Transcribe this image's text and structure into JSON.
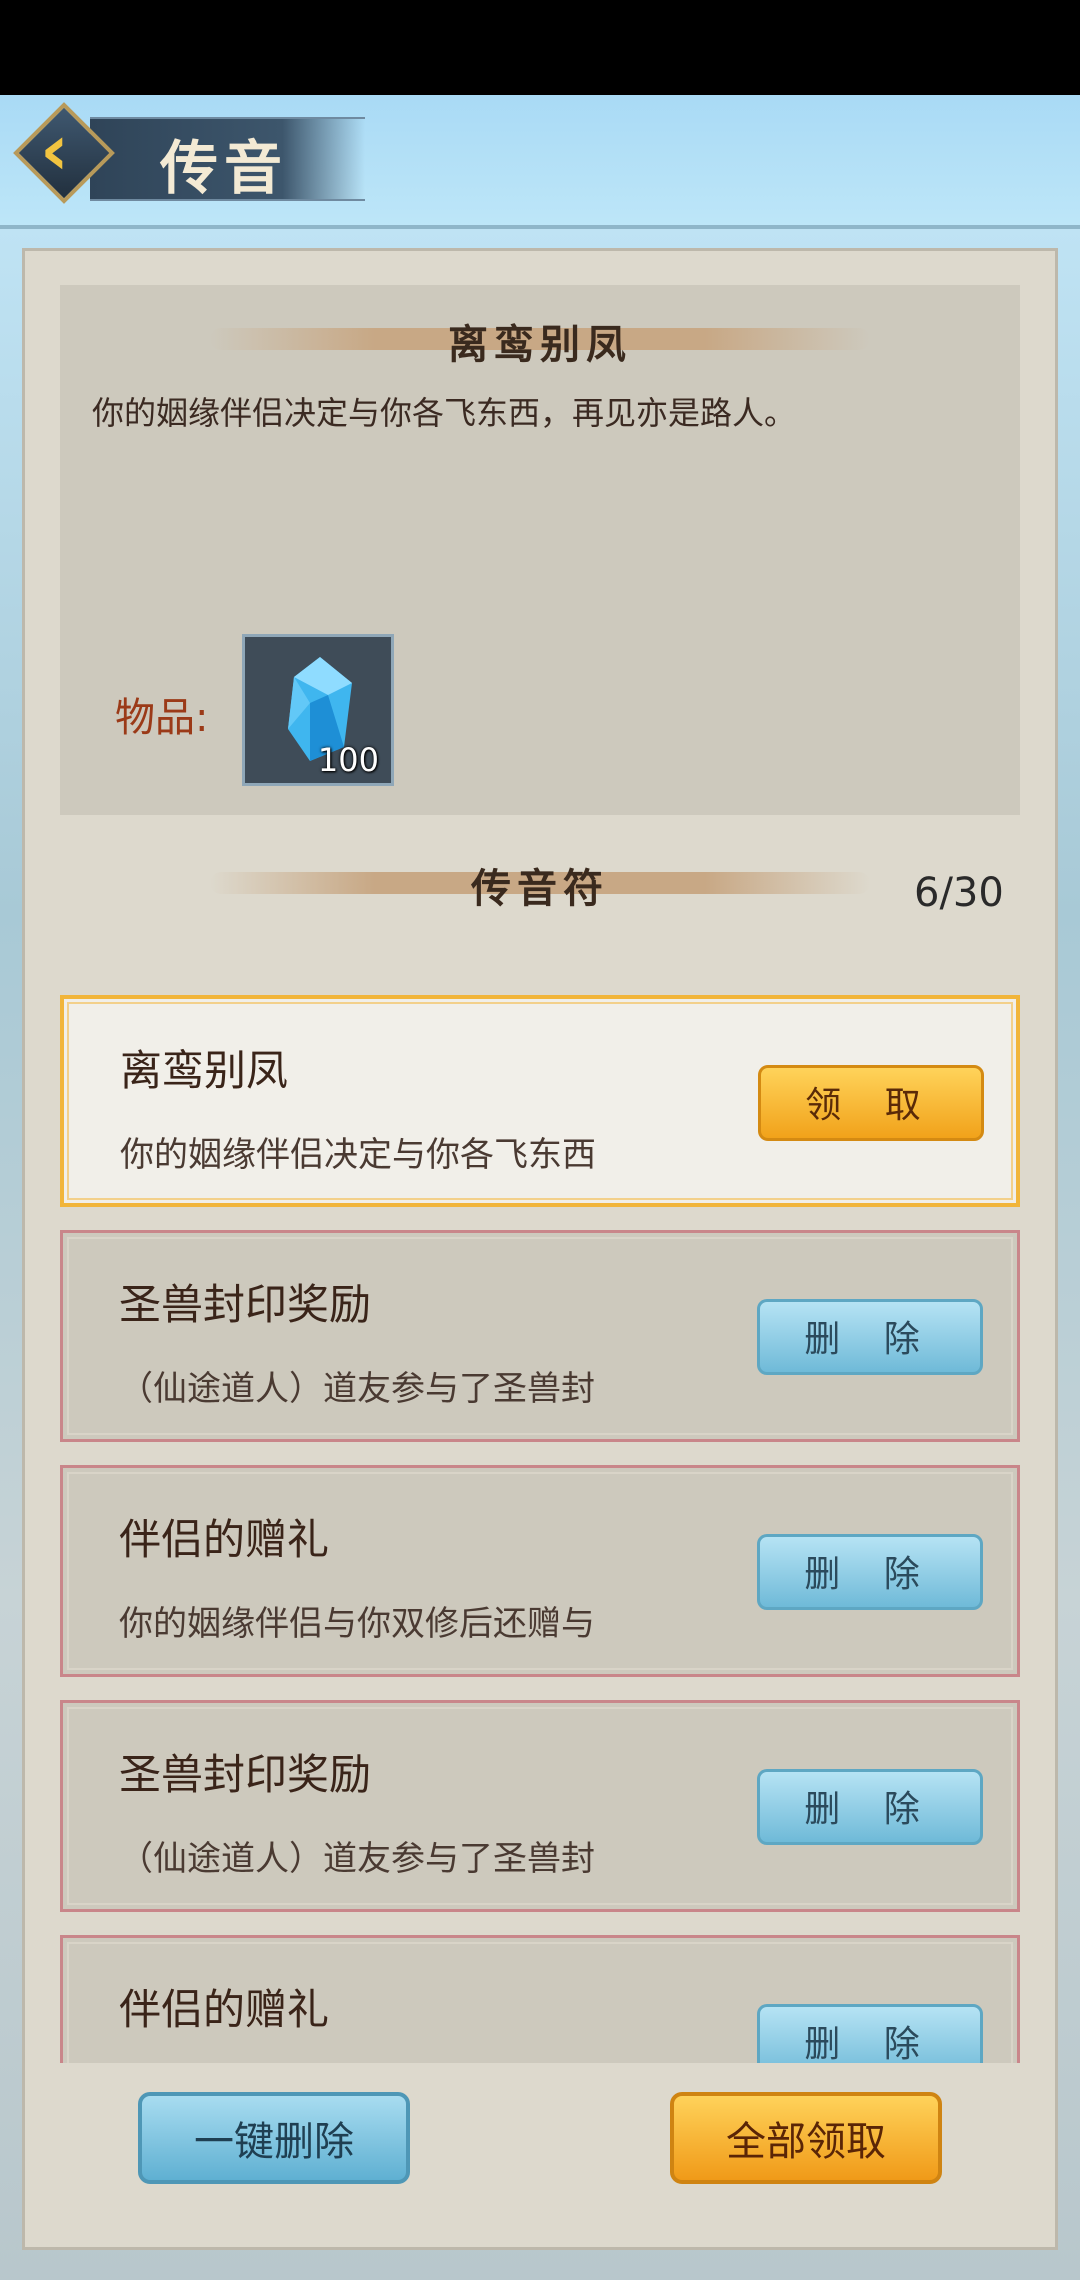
{
  "header": {
    "title": "传音"
  },
  "mail": {
    "heading": "离鸾别凤",
    "body": "你的姻缘伴侣决定与你各飞东西，再见亦是路人。",
    "items_label": "物品:",
    "attachment": {
      "icon": "blue-crystal-icon",
      "count": "100"
    }
  },
  "inbox": {
    "heading": "传音符",
    "count": "6/30",
    "messages": [
      {
        "title": "离鸾别凤",
        "preview": "你的姻缘伴侣决定与你各飞东西",
        "action": "领 取",
        "selected": true
      },
      {
        "title": "圣兽封印奖励",
        "preview": "（仙途道人）道友参与了圣兽封",
        "action": "删 除"
      },
      {
        "title": "伴侣的赠礼",
        "preview": "你的姻缘伴侣与你双修后还赠与",
        "action": "删 除"
      },
      {
        "title": "圣兽封印奖励",
        "preview": "（仙途道人）道友参与了圣兽封",
        "action": "删 除"
      },
      {
        "title": "伴侣的赠礼",
        "preview": "",
        "action": "删 除"
      }
    ]
  },
  "footer": {
    "delete_all": "一键删除",
    "claim_all": "全部领取"
  },
  "colors": {
    "gold": "#f1a21a",
    "blue": "#6fbad8",
    "panel": "#ddd9cd"
  }
}
